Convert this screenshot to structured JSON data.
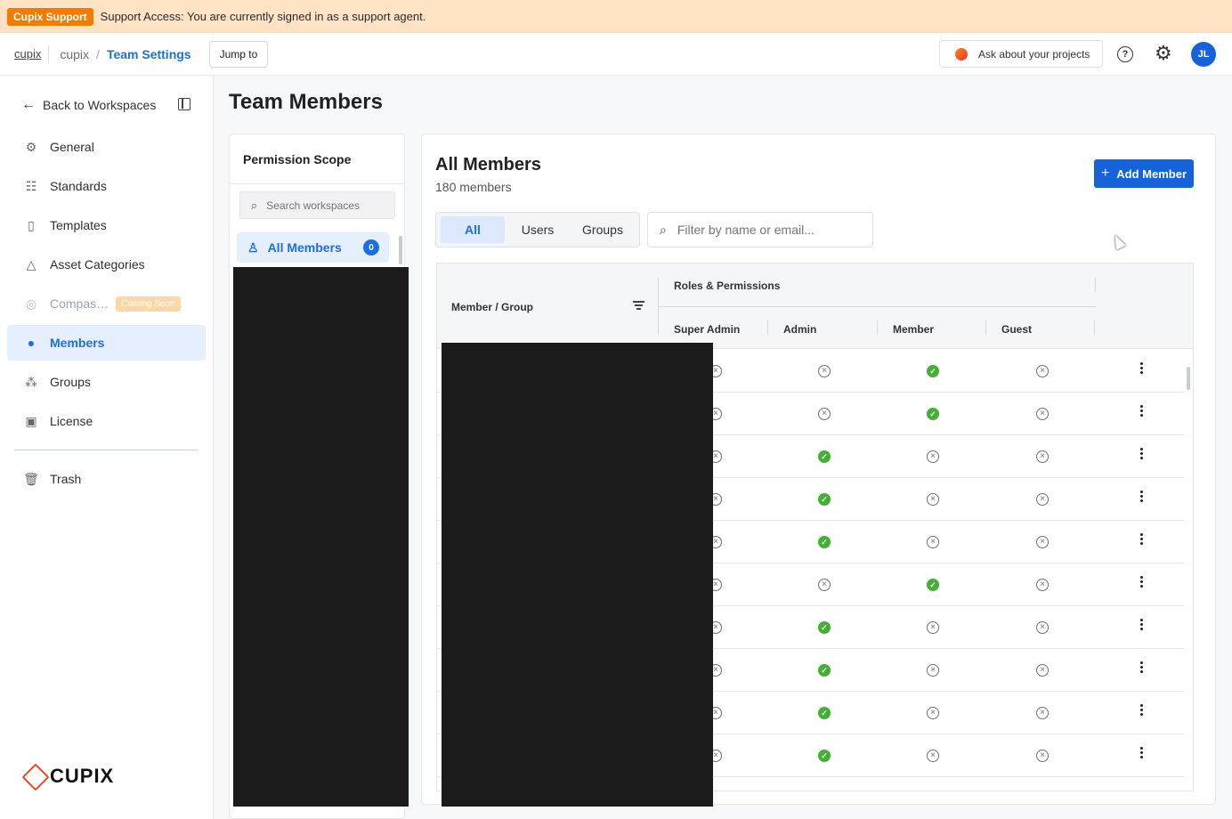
{
  "banner": {
    "badge": "Cupix Support",
    "text": "Support Access: You are currently signed in as a support agent."
  },
  "topbar": {
    "brand_link": "cupix",
    "crumb_org": "cupix",
    "crumb_separator": "/",
    "crumb_current": "Team Settings",
    "jump_label": "Jump to",
    "ask_label": "Ask about your projects",
    "help_glyph": "?",
    "avatar_initials": "JL"
  },
  "sidebar": {
    "back_label": "Back to Workspaces",
    "items": [
      {
        "label": "General",
        "icon": "gear-icon"
      },
      {
        "label": "Standards",
        "icon": "sliders-icon"
      },
      {
        "label": "Templates",
        "icon": "document-icon"
      },
      {
        "label": "Asset Categories",
        "icon": "shapes-icon"
      },
      {
        "label": "Compas…",
        "icon": "compass-icon",
        "badge": "Coming Soon"
      },
      {
        "label": "Members",
        "icon": "person-icon",
        "active": true
      },
      {
        "label": "Groups",
        "icon": "group-icon"
      },
      {
        "label": "License",
        "icon": "license-icon"
      },
      {
        "label": "Trash",
        "icon": "trash-icon"
      }
    ],
    "logo_text": "CUPIX"
  },
  "page": {
    "title": "Team Members"
  },
  "scope": {
    "title": "Permission Scope",
    "search_placeholder": "Search workspaces",
    "all_members_label": "All Members",
    "all_members_count": "0"
  },
  "members": {
    "title": "All Members",
    "count_text": "180 members",
    "add_label": "Add Member",
    "tabs": [
      {
        "label": "All",
        "active": true
      },
      {
        "label": "Users"
      },
      {
        "label": "Groups"
      }
    ],
    "filter_placeholder": "Filter by name or email...",
    "table": {
      "col_member": "Member / Group",
      "col_group_roles": "Roles & Permissions",
      "roles": [
        "Super Admin",
        "Admin",
        "Member",
        "Guest"
      ],
      "rows": [
        [
          "no",
          "no",
          "yes",
          "no"
        ],
        [
          "no",
          "no",
          "yes",
          "no"
        ],
        [
          "no",
          "yes",
          "no",
          "no"
        ],
        [
          "no",
          "yes",
          "no",
          "no"
        ],
        [
          "no",
          "yes",
          "no",
          "no"
        ],
        [
          "no",
          "no",
          "yes",
          "no"
        ],
        [
          "no",
          "yes",
          "no",
          "no"
        ],
        [
          "no",
          "yes",
          "no",
          "no"
        ],
        [
          "no",
          "yes",
          "no",
          "no"
        ],
        [
          "no",
          "yes",
          "no",
          "no"
        ]
      ]
    }
  },
  "colors": {
    "accent": "#1662d9",
    "banner": "#fde3c4",
    "badge": "#f07d00",
    "check": "#43b035",
    "redaction": "#1b1b1b"
  }
}
